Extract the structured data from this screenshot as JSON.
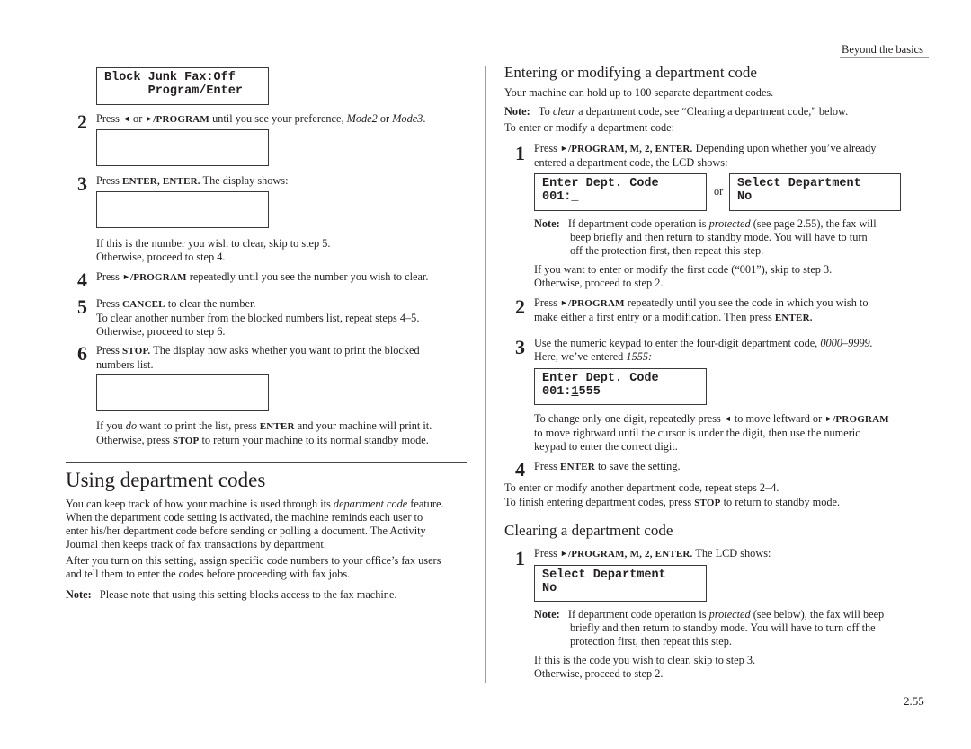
{
  "header": {
    "section": "Beyond the basics",
    "page_number": "2.55"
  },
  "left": {
    "lcd_block_junk": {
      "line1": "Block Junk Fax:Off",
      "line2": "      Program/Enter"
    },
    "step2": {
      "num": "2",
      "pre": "Press ",
      "left_arrow": "◄",
      "or": " or ",
      "right_arrow": "►",
      "key": "/PROGRAM",
      "mid": " until you see your preference, ",
      "opt1": "Mode2",
      "or2": " or ",
      "opt2": "Mode3",
      "end": "."
    },
    "step3": {
      "num": "3",
      "pre": "Press ",
      "keys": "ENTER, ENTER.",
      "post": " The display shows:"
    },
    "skip_text": {
      "line1": "If this is the number you wish to clear, skip to step 5.",
      "line2": "Otherwise, proceed to step 4."
    },
    "step4": {
      "num": "4",
      "pre": "Press ",
      "right_arrow": "►",
      "key": "/PROGRAM",
      "post": " repeatedly until you see the number you wish to clear."
    },
    "step5": {
      "num": "5",
      "pre": "Press ",
      "key": "CANCEL",
      "post": " to clear the number.",
      "line2": "To clear another number from the blocked numbers list, repeat steps 4–5.",
      "line3": "Otherwise, proceed to step 6."
    },
    "step6": {
      "num": "6",
      "pre": "Press ",
      "key": "STOP.",
      "post": " The display now asks whether you want to print the blocked",
      "line2": "numbers list."
    },
    "print_text": {
      "l1_pre": "If you ",
      "l1_em": "do",
      "l1_mid": " want to print the list, press ",
      "l1_key": "ENTER",
      "l1_post": " and your machine will print it.",
      "l2_pre": "Otherwise, press ",
      "l2_key": "STOP",
      "l2_post": " to return your machine to its normal standby mode."
    },
    "section_title": "Using department codes",
    "para1": {
      "l1_pre": "You can keep track of how your machine is used through its ",
      "l1_em": "department code",
      "l1_post": " feature.",
      "l2": "When the department code setting is activated, the machine reminds each user to",
      "l3": "enter his/her department code before sending or polling a document. The Activity",
      "l4": "Journal then keeps track of fax transactions by department."
    },
    "para2": {
      "l1": "After you turn on this setting, assign specific code numbers to your office’s fax users",
      "l2": "and tell them to enter the codes before proceeding with fax jobs."
    },
    "note": {
      "label": "Note:",
      "text": "Please note that using this setting blocks access to the fax machine."
    }
  },
  "right": {
    "entering_title": "Entering or modifying a department code",
    "capacity": "Your machine can hold up to 100 separate department codes.",
    "note_clear": {
      "label": "Note:",
      "pre": "To ",
      "em": "clear",
      "post": " a department code, see “Clearing a department code,” below."
    },
    "intro": "To enter or modify a department code:",
    "step1": {
      "num": "1",
      "pre": "Press ",
      "right_arrow": "►",
      "keys": "/PROGRAM, M, 2, ENTER.",
      "post": " Depending upon whether you’ve already",
      "l2_pre": "entered a department code, the ",
      "l2_sc": "LCD",
      "l2_post": " shows:"
    },
    "lcd_enter_code": {
      "line1": "Enter Dept. Code",
      "line2": "001:_"
    },
    "or_label": "or",
    "lcd_select_dept": {
      "line1": "Select Department",
      "line2": "No"
    },
    "note_protected": {
      "label": "Note:",
      "l1_pre": "If department code operation is ",
      "l1_em": "protected",
      "l1_post": " (see page 2.55), the fax will",
      "l2": "beep briefly and then return to standby mode. You will have to turn",
      "l3": "off the protection first, then repeat this step."
    },
    "skip_text": {
      "line1": "If you want to enter or modify the first code (“001”), skip to step 3.",
      "line2": "Otherwise, proceed to step 2."
    },
    "step2": {
      "num": "2",
      "pre": "Press ",
      "right_arrow": "►",
      "key": "/PROGRAM",
      "post": " repeatedly until you see the code in which you wish to",
      "l2_pre": "make either a first entry or a modification. Then press ",
      "l2_key": "ENTER."
    },
    "step3": {
      "num": "3",
      "pre": "Use the numeric keypad to enter the four-digit department code, ",
      "em": "0000–9999.",
      "l2_pre": "Here, we’ve entered ",
      "l2_em": "1555:"
    },
    "lcd_entered": {
      "line1": "Enter Dept. Code",
      "line2_prefix": "001:",
      "line2_cursor": "1",
      "line2_rest": "555"
    },
    "change_digit": {
      "l1_pre": "To change only one digit, repeatedly press ",
      "left_arrow": "◄",
      "l1_mid": " to move leftward or ",
      "right_arrow": "►",
      "l1_key": "/PROGRAM",
      "l2": "to move rightward until the cursor is under the digit, then use the numeric",
      "l3": "keypad to enter the correct digit."
    },
    "step4": {
      "num": "4",
      "pre": "Press ",
      "key": "ENTER",
      "post": " to save the setting."
    },
    "repeat_text": "To enter or modify another department code, repeat steps 2–4.",
    "finish_text": {
      "pre": "To finish entering department codes, press ",
      "key": "STOP",
      "post": " to return to standby mode."
    },
    "clearing_title": "Clearing a department code",
    "clear_step1": {
      "num": "1",
      "pre": "Press ",
      "right_arrow": "►",
      "keys": "/PROGRAM, M, 2, ENTER.",
      "post": " The ",
      "sc": "LCD",
      "post2": " shows:"
    },
    "lcd_clear": {
      "line1": "Select Department",
      "line2": "No"
    },
    "clear_note": {
      "label": "Note:",
      "l1_pre": "If department code operation is ",
      "l1_em": "protected",
      "l1_post": " (see below), the fax will beep",
      "l2": "briefly and then return to standby mode. You will have to turn off the",
      "l3": "protection first, then repeat this step."
    },
    "clear_skip": {
      "line1": "If this is the code you wish to clear, skip to step 3.",
      "line2": "Otherwise, proceed to step 2."
    }
  }
}
